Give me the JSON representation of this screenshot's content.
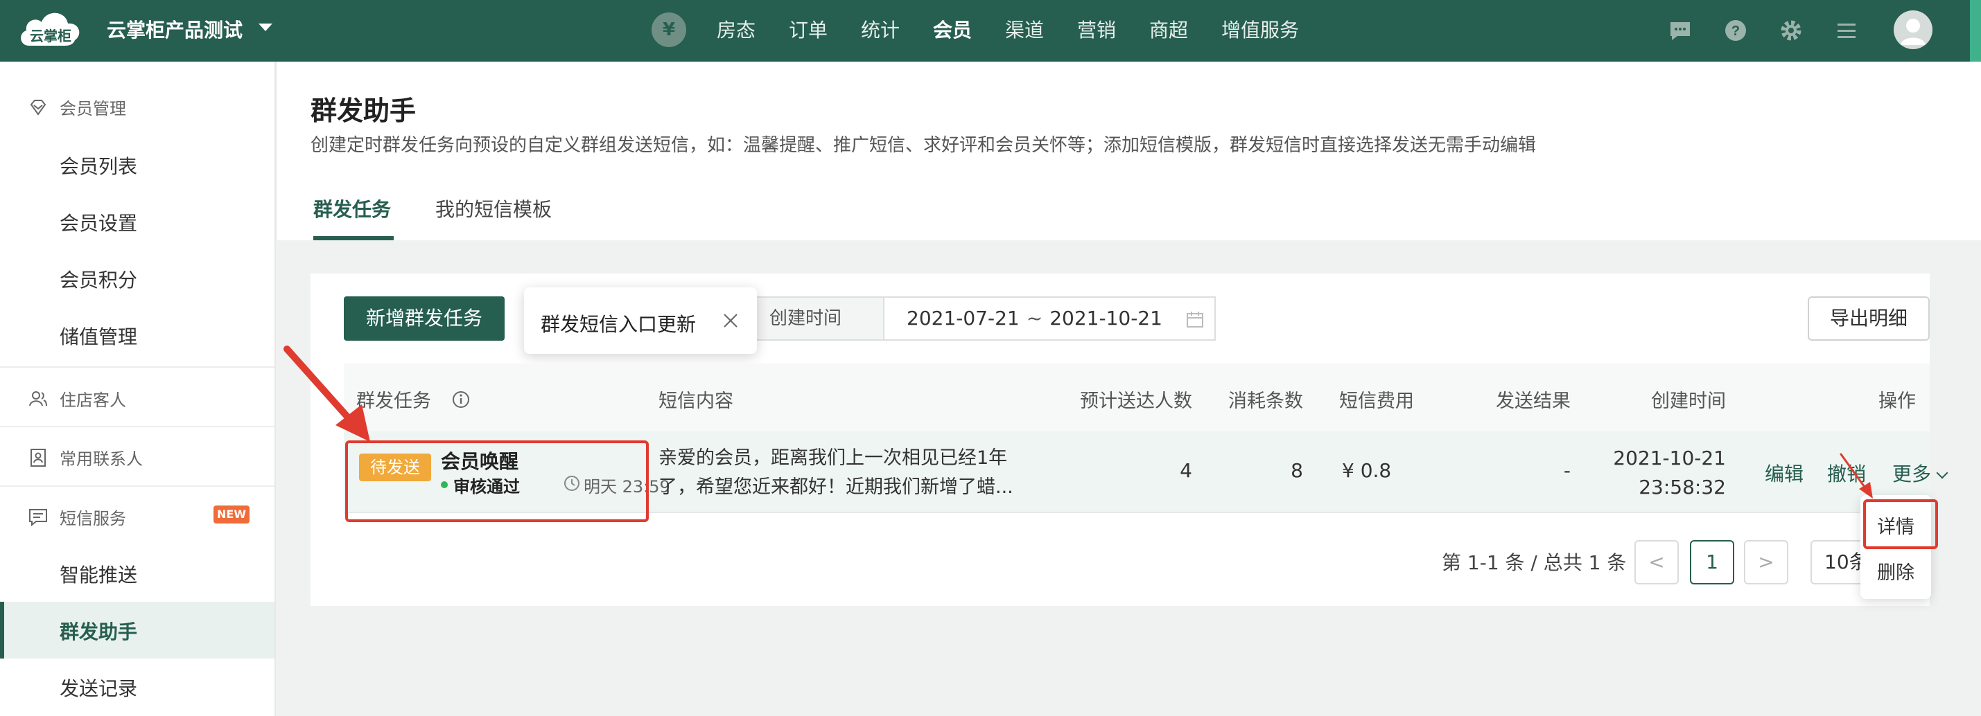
{
  "topbar": {
    "logo_text": "云掌柜",
    "shop_name": "云掌柜产品测试",
    "currency_symbol": "¥",
    "nav": [
      "房态",
      "订单",
      "统计",
      "会员",
      "渠道",
      "营销",
      "商超",
      "增值服务"
    ],
    "active_nav": "会员",
    "icons": [
      "message-icon",
      "help-icon",
      "settings-icon",
      "menu-icon",
      "avatar"
    ],
    "brand_color": "#265e4f"
  },
  "sidebar": {
    "groups": [
      {
        "title": "会员管理",
        "icon": "member-management-icon",
        "items": [
          "会员列表",
          "会员设置",
          "会员积分",
          "储值管理"
        ]
      },
      {
        "title": "住店客人",
        "icon": "guest-icon",
        "items": []
      },
      {
        "title": "常用联系人",
        "icon": "contact-icon",
        "items": []
      },
      {
        "title": "短信服务",
        "icon": "sms-icon",
        "badge": "NEW",
        "items": [
          "智能推送",
          "群发助手",
          "发送记录"
        ]
      }
    ],
    "active_item": "群发助手"
  },
  "page": {
    "title": "群发助手",
    "description": "创建定时群发任务向预设的自定义群组发送短信，如：温馨提醒、推广短信、求好评和会员关怀等；添加短信模版，群发短信时直接选择发送无需手动编辑",
    "tabs": [
      "群发任务",
      "我的短信模板"
    ],
    "active_tab": "群发任务"
  },
  "toolbar": {
    "new_task_label": "新增群发任务",
    "popover_text": "群发短信入口更新",
    "filter_label": "创建时间",
    "date_start": "2021-07-21",
    "date_sep": "~",
    "date_end": "2021-10-21",
    "export_label": "导出明细"
  },
  "table": {
    "columns": [
      "群发任务",
      "短信内容",
      "预计送达人数",
      "消耗条数",
      "短信费用",
      "发送结果",
      "创建时间",
      "操作"
    ],
    "rows": [
      {
        "status_tag": "待发送",
        "name": "会员唤醒",
        "review_status": "审核通过",
        "send_time": "明天 23:59",
        "content_line1": "亲爱的会员，距离我们上一次相见已经1年",
        "content_line2": "了，希望您近来都好！近期我们新增了蜡...",
        "recipients": "4",
        "count": "8",
        "fee": "¥ 0.8",
        "result": "-",
        "created_date": "2021-10-21",
        "created_time": "23:58:32",
        "actions": [
          "编辑",
          "撤销",
          "更多"
        ]
      }
    ]
  },
  "pagination": {
    "info": "第 1-1 条 / 总共 1 条",
    "prev": "<",
    "current": "1",
    "next": ">",
    "page_size": "10条"
  },
  "more_menu": [
    "详情",
    "删除"
  ],
  "annotation_color": "#e03b2f"
}
